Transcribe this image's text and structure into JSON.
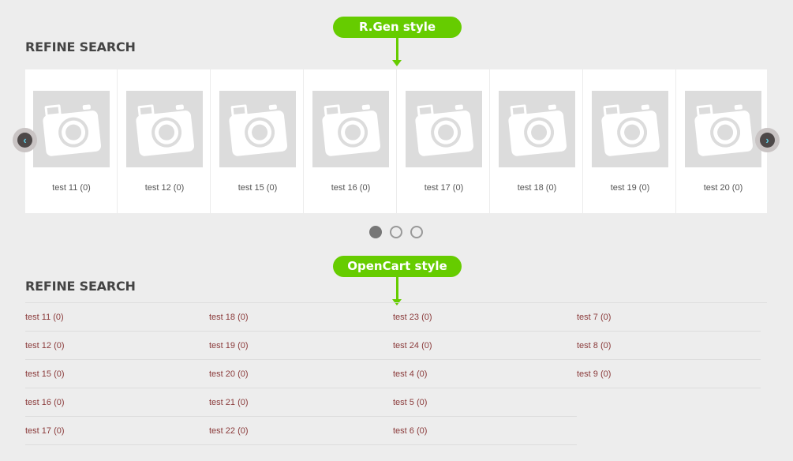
{
  "badges": {
    "top": "R.Gen style",
    "bottom": "OpenCart style"
  },
  "section_titles": {
    "top": "REFINE SEARCH",
    "bottom": "REFINE SEARCH"
  },
  "colors": {
    "badge_green": "#66cc00",
    "link_color": "#8a3a3a",
    "arrow_cyan": "#5fd0e6"
  },
  "carousel": {
    "items": [
      {
        "label": "test 11 (0)"
      },
      {
        "label": "test 12 (0)"
      },
      {
        "label": "test 15 (0)"
      },
      {
        "label": "test 16 (0)"
      },
      {
        "label": "test 17 (0)"
      },
      {
        "label": "test 18 (0)"
      },
      {
        "label": "test 19 (0)"
      },
      {
        "label": "test 20 (0)"
      }
    ],
    "prev_icon": "chevron-left-icon",
    "next_icon": "chevron-right-icon",
    "placeholder_icon": "camera-icon",
    "pagination": {
      "pages": 3,
      "active": 1
    }
  },
  "category_list": {
    "columns": [
      [
        "test 11 (0)",
        "test 12 (0)",
        "test 15 (0)",
        "test 16 (0)",
        "test 17 (0)"
      ],
      [
        "test 18 (0)",
        "test 19 (0)",
        "test 20 (0)",
        "test 21 (0)",
        "test 22 (0)"
      ],
      [
        "test 23 (0)",
        "test 24 (0)",
        "test 4 (0)",
        "test 5 (0)",
        "test 6 (0)"
      ],
      [
        "test 7 (0)",
        "test 8 (0)",
        "test 9 (0)"
      ]
    ]
  }
}
